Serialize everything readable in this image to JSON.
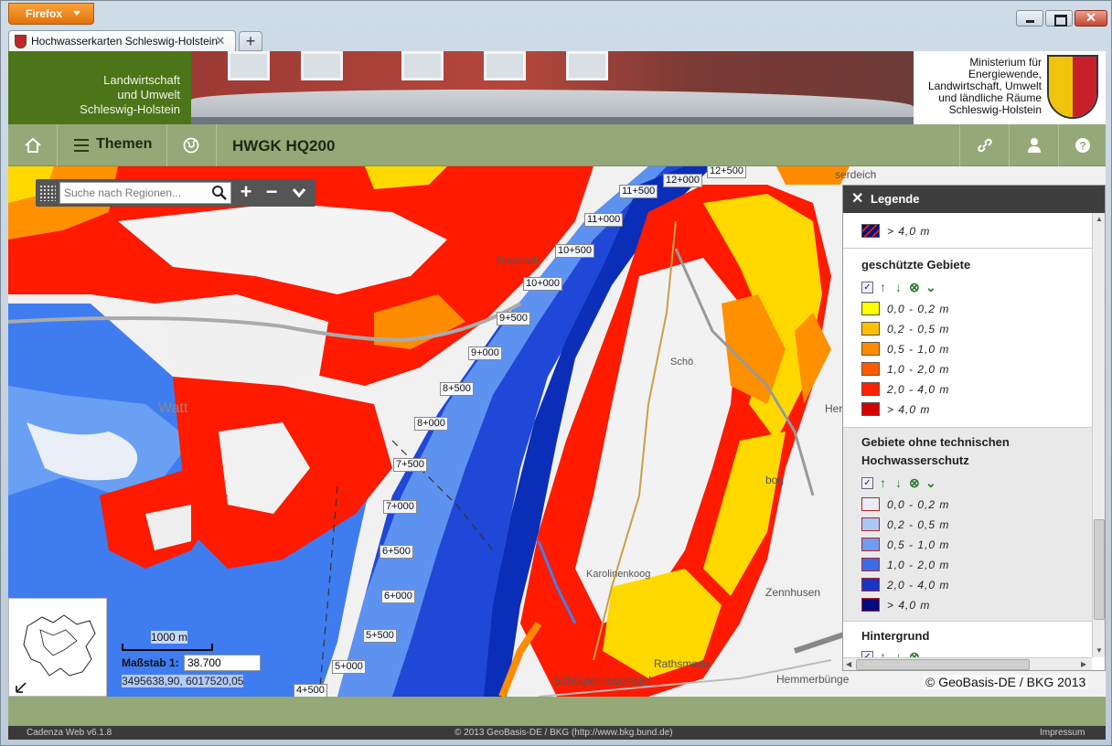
{
  "browser": {
    "app_button": "Firefox",
    "tab_title": "Hochwasserkarten Schleswig-Holstein",
    "new_tab": "+",
    "close_symbol": "✕"
  },
  "banner": {
    "left_text": [
      "Landwirtschaft",
      "und Umwelt",
      "Schleswig-Holstein"
    ],
    "ministry_lines": [
      "Ministerium für",
      "Energiewende,",
      "Landwirtschaft, Umwelt",
      "und ländliche Räume",
      "Schleswig-Holstein"
    ]
  },
  "nav": {
    "themen": "Themen",
    "title": "HWGK HQ200"
  },
  "search": {
    "placeholder": "Suche nach Regionen..."
  },
  "map": {
    "stations": [
      "12+500",
      "12+000",
      "11+500",
      "11+000",
      "10+500",
      "10+000",
      "9+500",
      "9+000",
      "8+500",
      "8+000",
      "7+500",
      "7+000",
      "6+500",
      "6+000",
      "5+500",
      "5+000",
      "4+500"
    ],
    "places": [
      "Posteloh",
      "Watt",
      "Zennhusen",
      "Rathsmede",
      "Schülperneuensiel",
      "Hemmerbünge",
      "serdeich",
      "Her",
      "bog",
      "Schö",
      "Karolinenkoog"
    ],
    "copyright": "© GeoBasis-DE / BKG 2013"
  },
  "scale": {
    "bar_label": "1000 m",
    "label": "Maßstab",
    "prefix": "1:",
    "value": "38.700",
    "coords": "3495638,90, 6017520,05"
  },
  "legend": {
    "title": "Legende",
    "top_partial_row": "> 4,0 m",
    "sections": [
      {
        "title": "geschützte Gebiete",
        "rows": [
          {
            "label": "0,0 - 0,2 m",
            "color": "#ffff00"
          },
          {
            "label": "0,2 - 0,5 m",
            "color": "#ffc000"
          },
          {
            "label": "0,5 - 1,0 m",
            "color": "#ff8c00"
          },
          {
            "label": "1,0 - 2,0 m",
            "color": "#ff5a00"
          },
          {
            "label": "2,0 - 4,0 m",
            "color": "#ff2000"
          },
          {
            "label": "> 4,0 m",
            "color": "#d40000"
          }
        ]
      },
      {
        "title": "Gebiete ohne technischen Hochwasserschutz",
        "rows": [
          {
            "label": "0,0 - 0,2 m",
            "color": "#e6eefc"
          },
          {
            "label": "0,2 - 0,5 m",
            "color": "#a8c8f8"
          },
          {
            "label": "0,5 - 1,0 m",
            "color": "#6e9ef0"
          },
          {
            "label": "1,0 - 2,0 m",
            "color": "#3a6ee8"
          },
          {
            "label": "2,0 - 4,0 m",
            "color": "#1437c8"
          },
          {
            "label": "> 4,0 m",
            "color": "#000c80"
          }
        ]
      },
      {
        "title": "Hintergrund",
        "rows": []
      }
    ]
  },
  "footer": {
    "version": "Cadenza Web v6.1.8",
    "copyright": "© 2013 GeoBasis-DE / BKG (http://www.bkg.bund.de)",
    "impressum": "Impressum"
  },
  "colors": {
    "nav_green": "#95a878",
    "banner_green": "#4c7519",
    "flood_red": "#ff1a00",
    "river_blue": "#1a3fd0"
  }
}
